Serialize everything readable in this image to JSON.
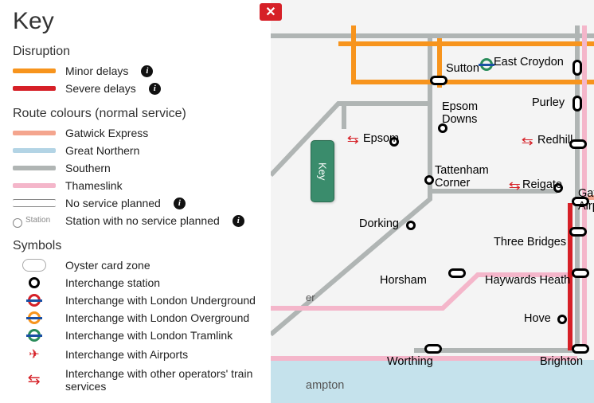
{
  "panel": {
    "title": "Key",
    "close_label": "✕",
    "tab_label": "Key"
  },
  "disruption": {
    "heading": "Disruption",
    "minor": "Minor delays",
    "severe": "Severe delays"
  },
  "routes": {
    "heading": "Route colours (normal service)",
    "gatwick": "Gatwick Express",
    "northern": "Great Northern",
    "southern": "Southern",
    "thameslink": "Thameslink",
    "noservice": "No service planned",
    "station_noservice": "Station with no service planned"
  },
  "symbols": {
    "heading": "Symbols",
    "oyster": "Oyster card zone",
    "interchange": "Interchange station",
    "underground": "Interchange with London Underground",
    "overground": "Interchange with London Overground",
    "tramlink": "Interchange with London Tramlink",
    "airports": "Interchange with Airports",
    "rail": "Interchange with other operators' train services"
  },
  "stations": {
    "sutton": "Sutton",
    "east_croydon": "East Croydon",
    "epsom_downs": "Epsom Downs",
    "purley": "Purley",
    "epsom": "Epsom",
    "redhill": "Redhill",
    "tattenham_corner": "Tattenham Corner",
    "reigate": "Reigate",
    "dorking": "Dorking",
    "gatwick_airport": "Gatwick Airport",
    "three_bridges": "Three Bridges",
    "horsham": "Horsham",
    "haywards_heath": "Haywards Heath",
    "hove": "Hove",
    "worthing": "Worthing",
    "brighton": "Brighton",
    "ampton": "ampton",
    "er": "er"
  },
  "info_glyph": "i",
  "plane_glyph": "✈",
  "rail_glyph": "⇆"
}
